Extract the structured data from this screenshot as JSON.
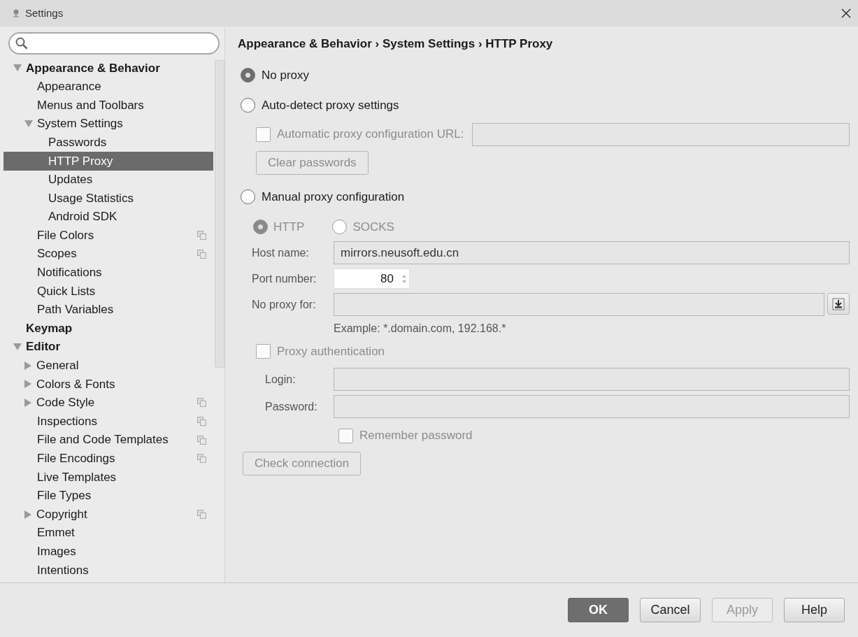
{
  "window": {
    "title": "Settings"
  },
  "tree": [
    {
      "label": "Appearance & Behavior",
      "kind": "group",
      "expanded": true,
      "selected": false,
      "copy_icon": false,
      "children": [
        {
          "label": "Appearance",
          "kind": "page",
          "selected": false,
          "copy_icon": false
        },
        {
          "label": "Menus and Toolbars",
          "kind": "page",
          "selected": false,
          "copy_icon": false
        },
        {
          "label": "System Settings",
          "kind": "page",
          "expanded": true,
          "selected": false,
          "copy_icon": false,
          "children": [
            {
              "label": "Passwords",
              "kind": "page",
              "selected": false,
              "copy_icon": false
            },
            {
              "label": "HTTP Proxy",
              "kind": "page",
              "selected": true,
              "copy_icon": false
            },
            {
              "label": "Updates",
              "kind": "page",
              "selected": false,
              "copy_icon": false
            },
            {
              "label": "Usage Statistics",
              "kind": "page",
              "selected": false,
              "copy_icon": false
            },
            {
              "label": "Android SDK",
              "kind": "page",
              "selected": false,
              "copy_icon": false
            }
          ]
        },
        {
          "label": "File Colors",
          "kind": "page",
          "selected": false,
          "copy_icon": true
        },
        {
          "label": "Scopes",
          "kind": "page",
          "selected": false,
          "copy_icon": true
        },
        {
          "label": "Notifications",
          "kind": "page",
          "selected": false,
          "copy_icon": false
        },
        {
          "label": "Quick Lists",
          "kind": "page",
          "selected": false,
          "copy_icon": false
        },
        {
          "label": "Path Variables",
          "kind": "page",
          "selected": false,
          "copy_icon": false
        }
      ]
    },
    {
      "label": "Keymap",
      "kind": "group",
      "selected": false,
      "copy_icon": false
    },
    {
      "label": "Editor",
      "kind": "group",
      "expanded": true,
      "selected": false,
      "copy_icon": false,
      "children": [
        {
          "label": "General",
          "kind": "page",
          "expanded": false,
          "selected": false,
          "copy_icon": false
        },
        {
          "label": "Colors & Fonts",
          "kind": "page",
          "expanded": false,
          "selected": false,
          "copy_icon": false
        },
        {
          "label": "Code Style",
          "kind": "page",
          "expanded": false,
          "selected": false,
          "copy_icon": true
        },
        {
          "label": "Inspections",
          "kind": "page",
          "selected": false,
          "copy_icon": true
        },
        {
          "label": "File and Code Templates",
          "kind": "page",
          "selected": false,
          "copy_icon": true
        },
        {
          "label": "File Encodings",
          "kind": "page",
          "selected": false,
          "copy_icon": true
        },
        {
          "label": "Live Templates",
          "kind": "page",
          "selected": false,
          "copy_icon": false
        },
        {
          "label": "File Types",
          "kind": "page",
          "selected": false,
          "copy_icon": false
        },
        {
          "label": "Copyright",
          "kind": "page",
          "expanded": false,
          "selected": false,
          "copy_icon": true
        },
        {
          "label": "Emmet",
          "kind": "page",
          "selected": false,
          "copy_icon": false
        },
        {
          "label": "Images",
          "kind": "page",
          "selected": false,
          "copy_icon": false
        },
        {
          "label": "Intentions",
          "kind": "page",
          "selected": false,
          "copy_icon": false
        }
      ]
    }
  ],
  "breadcrumb": "Appearance & Behavior › System Settings › HTTP Proxy",
  "proxy_modes": [
    {
      "label": "No proxy",
      "selected": true
    },
    {
      "label": "Auto-detect proxy settings",
      "selected": false
    },
    {
      "label": "Manual proxy configuration",
      "selected": false
    }
  ],
  "auto_detect": {
    "pac_checkbox": {
      "label": "Automatic proxy configuration URL:",
      "checked": false,
      "disabled": true
    },
    "clear_button": {
      "label": "Clear passwords",
      "disabled": true
    }
  },
  "manual": {
    "disabled": true,
    "protocols": [
      {
        "label": "HTTP",
        "selected": true
      },
      {
        "label": "SOCKS",
        "selected": false
      }
    ],
    "host": {
      "label": "Host name:",
      "value": "mirrors.neusoft.edu.cn"
    },
    "port": {
      "label": "Port number:",
      "value": "80"
    },
    "no_proxy": {
      "label": "No proxy for:",
      "hint": "Example: *.domain.com, 192.168.*"
    },
    "auth": {
      "label": "Proxy authentication",
      "checked": false
    },
    "login": {
      "label": "Login:"
    },
    "password": {
      "label": "Password:"
    },
    "remember": {
      "label": "Remember password",
      "checked": false
    }
  },
  "check_button": {
    "label": "Check connection",
    "disabled": true
  },
  "buttons": [
    {
      "label": "OK",
      "kind": "default"
    },
    {
      "label": "Cancel",
      "kind": "normal"
    },
    {
      "label": "Apply",
      "kind": "disabled"
    },
    {
      "label": "Help",
      "kind": "normal"
    }
  ]
}
